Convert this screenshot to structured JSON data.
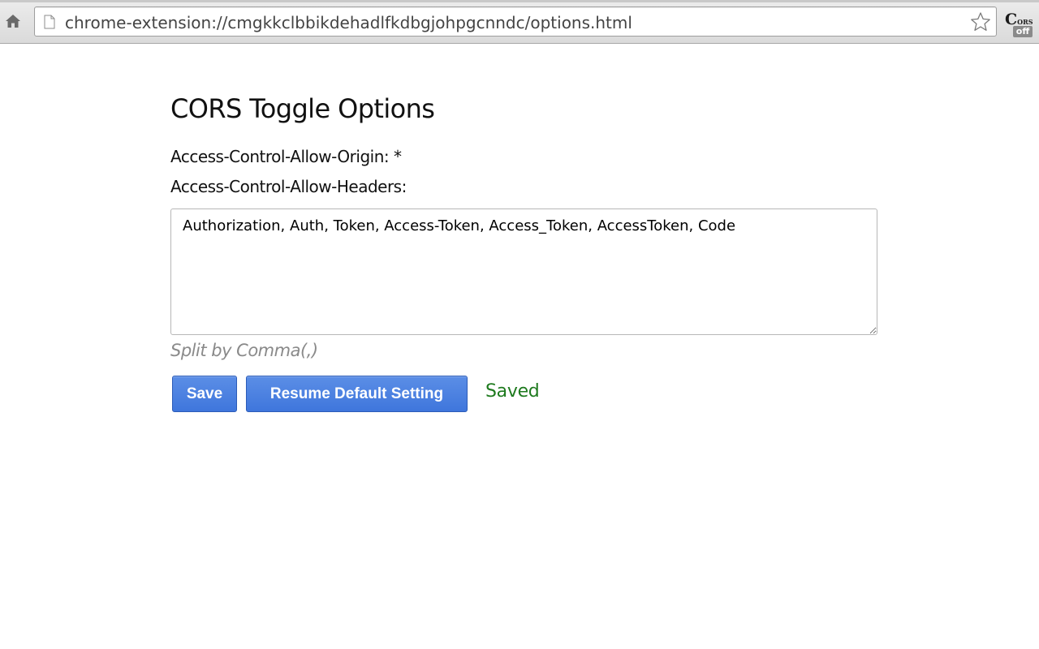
{
  "browser": {
    "url": "chrome-extension://cmgkkclbbikdehadlfkdbgjohpgcnndc/options.html",
    "extension": {
      "logo_main": "C",
      "logo_small": "ORS",
      "badge": "off"
    },
    "icons": {
      "home": "home-icon",
      "page": "page-icon",
      "bookmark": "star-icon"
    }
  },
  "page": {
    "title": "CORS Toggle Options",
    "origin_line": "Access-Control-Allow-Origin: *",
    "headers_label": "Access-Control-Allow-Headers:",
    "headers_value": "Authorization, Auth, Token, Access-Token, Access_Token, AccessToken, Code",
    "hint": "Split by Comma(,)",
    "save_label": "Save",
    "resume_label": "Resume Default Setting",
    "status": "Saved"
  },
  "colors": {
    "button_blue": "#4a80e0",
    "status_green": "#1e7a1e",
    "hint_gray": "#8a8a8a"
  }
}
